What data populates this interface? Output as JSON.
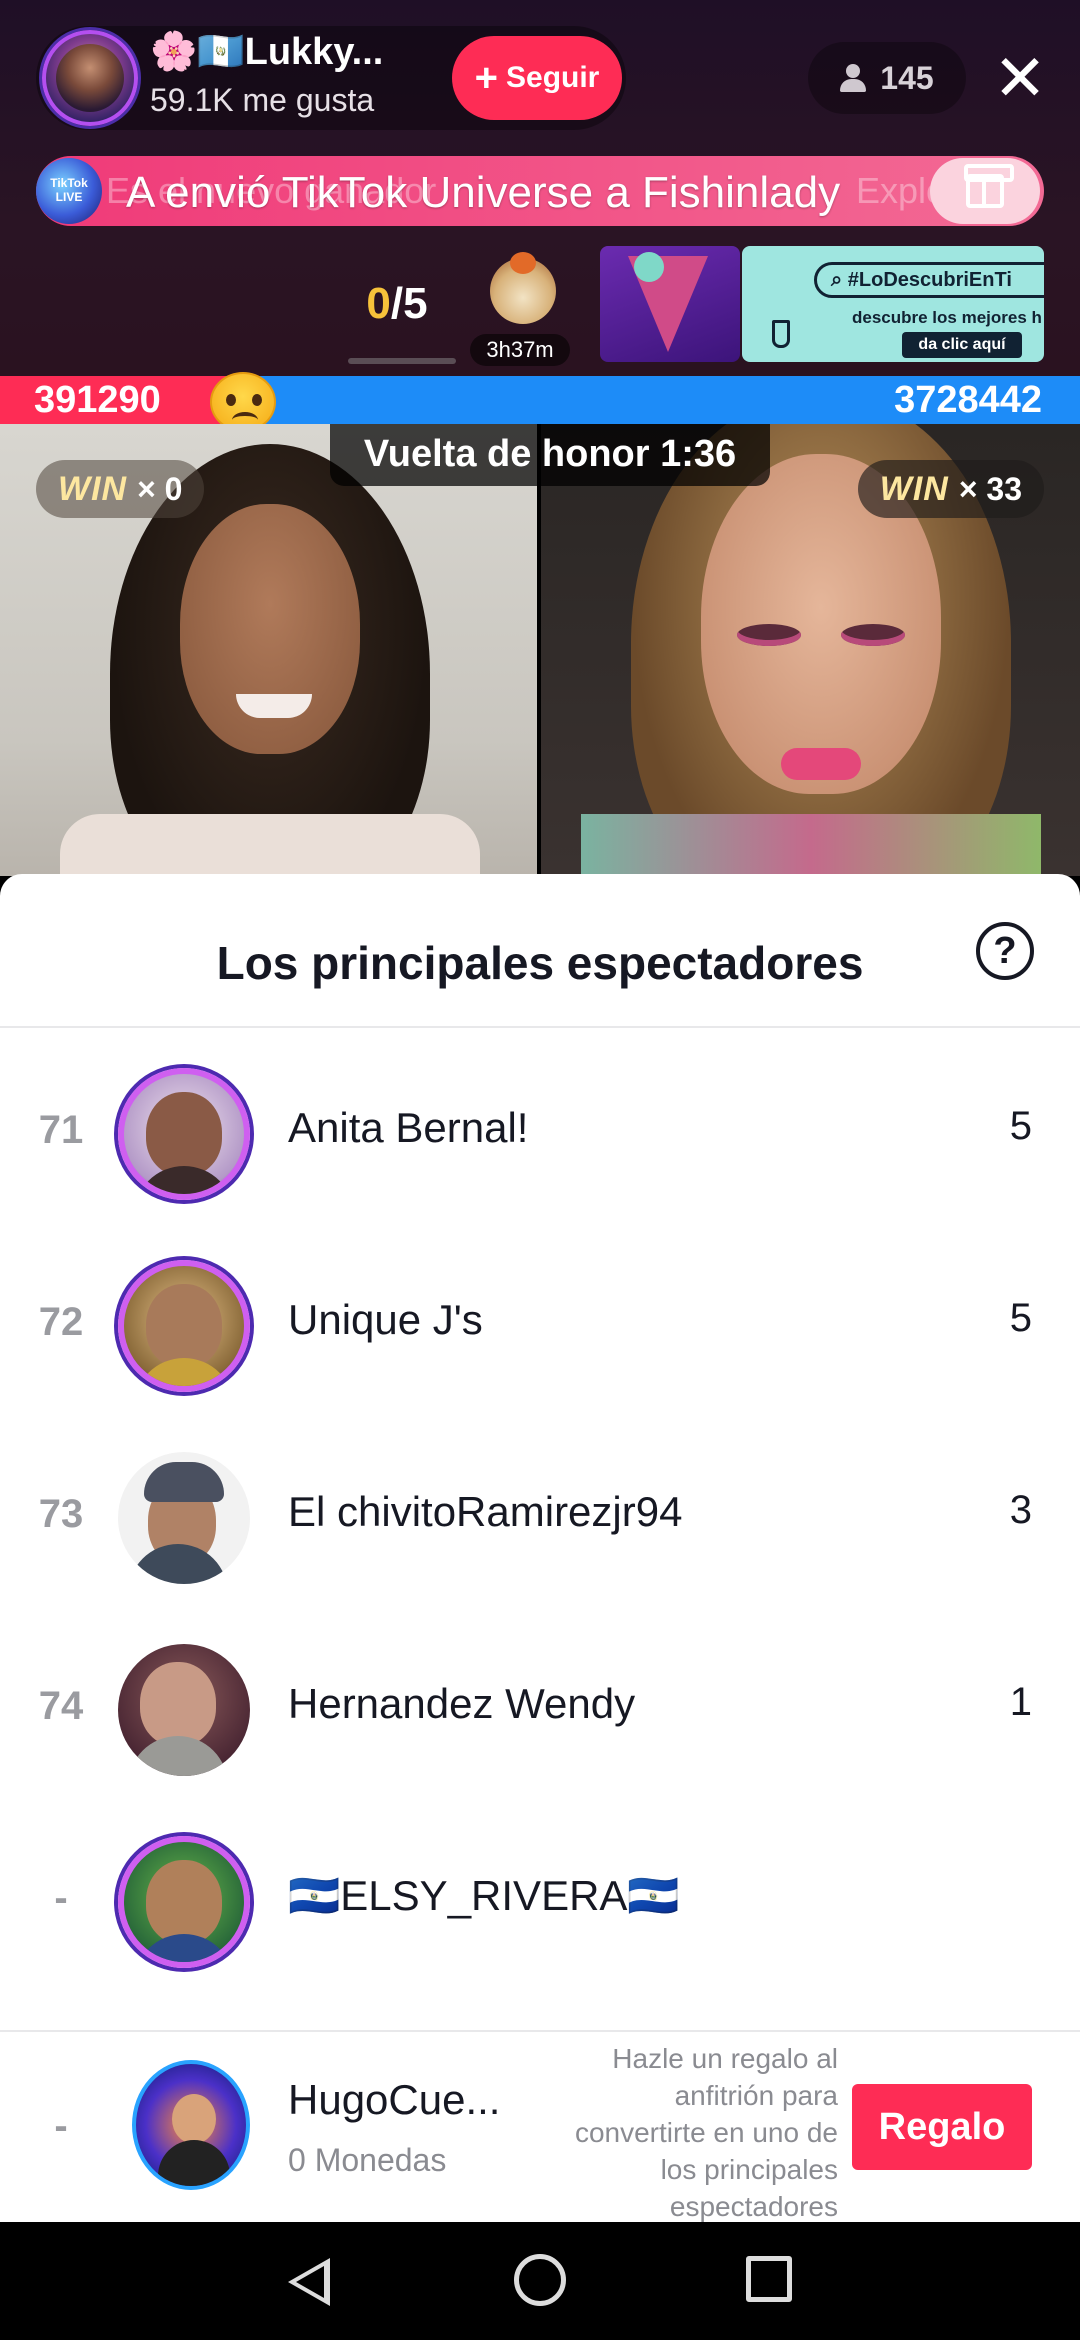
{
  "host": {
    "name": "🌸🇬🇹Lukky...",
    "likes": "59.1K me gusta",
    "follow_label": "Seguir",
    "viewer_count": "145"
  },
  "banner": {
    "message": "A envió TikTok Universe a Fishinlady",
    "ghost_left": "Es el nuevo ganador",
    "ghost_right": "Explorar",
    "badge_label": "TikTok LIVE"
  },
  "widgets": {
    "task_current": "0",
    "task_total": "/5",
    "timer": "3h37m",
    "promo_tag": "#LoDescubriEnTi",
    "promo_sub": "descubre los mejores h",
    "promo_cta": "da clic aquí"
  },
  "battle": {
    "left_score": "391290",
    "right_score": "3728442",
    "honor_label": "Vuelta de honor 1:36",
    "left_win_label": "WIN",
    "left_win_count": "× 0",
    "right_win_label": "WIN",
    "right_win_count": "× 33"
  },
  "sheet": {
    "title": "Los principales espectadores",
    "help_label": "?",
    "rows": [
      {
        "rank": "71",
        "name": "Anita Bernal!",
        "score": "5"
      },
      {
        "rank": "72",
        "name": "Unique J's",
        "score": "5"
      },
      {
        "rank": "73",
        "name": "El chivitoRamirezjr94",
        "score": "3"
      },
      {
        "rank": "74",
        "name": "Hernandez Wendy",
        "score": "1"
      },
      {
        "rank": "-",
        "name": "🇸🇻ELSY_RIVERA🇸🇻",
        "score": ""
      }
    ]
  },
  "me": {
    "rank": "-",
    "name": "HugoCue...",
    "coins": "0 Monedas",
    "hint": "Hazle un regalo al anfitrión para convertirte en uno de los principales espectadores",
    "gift_label": "Regalo"
  },
  "colors": {
    "accent": "#fe2c55",
    "blue_team": "#1d8cf8",
    "gold": "#f7c23a"
  }
}
